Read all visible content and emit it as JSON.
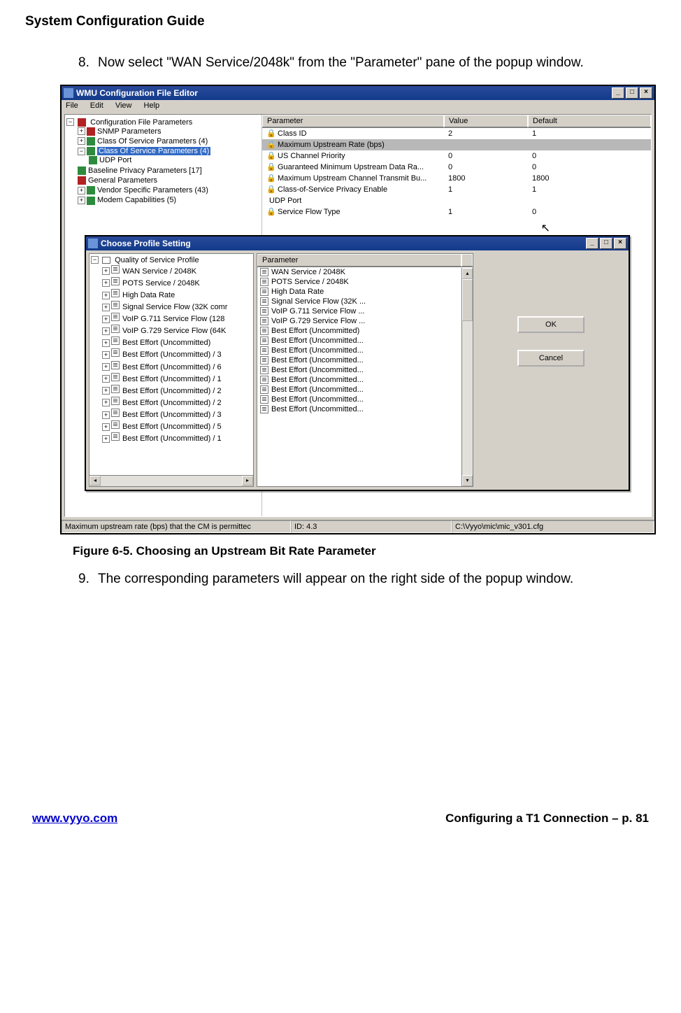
{
  "doc": {
    "guide_title": "System Configuration Guide",
    "step8_num": "8.",
    "step8": "Now select \"WAN Service/2048k\" from the \"Parameter\" pane of the popup window.",
    "figure_caption": "Figure 6-5. Choosing an Upstream Bit Rate Parameter",
    "step9_num": "9.",
    "step9": "The corresponding parameters will appear on the right side of the popup window.",
    "footer_left": "www.vyyo.com",
    "footer_right": "Configuring a T1 Connection – p. 81"
  },
  "editor": {
    "title": "WMU Configuration File Editor",
    "menu": {
      "file": "File",
      "edit": "Edit",
      "view": "View",
      "help": "Help"
    },
    "tree": {
      "root": "Configuration File Parameters",
      "items": [
        "SNMP Parameters",
        "Class Of Service Parameters (4)",
        "Class Of Service Parameters (4)",
        "UDP Port",
        "Baseline Privacy Parameters [17]",
        "General Parameters",
        "Vendor Specific Parameters (43)",
        "Modem Capabilities (5)"
      ]
    },
    "grid": {
      "headers": {
        "param": "Parameter",
        "value": "Value",
        "default": "Default"
      },
      "rows": [
        {
          "p": "Class ID",
          "v": "2",
          "d": "1"
        },
        {
          "p": "Maximum Upstream Rate (bps)",
          "v": "",
          "d": "",
          "sel": true
        },
        {
          "p": "US Channel Priority",
          "v": "0",
          "d": "0"
        },
        {
          "p": "Guaranteed Minimum Upstream Data Ra...",
          "v": "0",
          "d": "0"
        },
        {
          "p": "Maximum Upstream Channel Transmit Bu...",
          "v": "1800",
          "d": "1800"
        },
        {
          "p": "Class-of-Service Privacy Enable",
          "v": "1",
          "d": "1"
        },
        {
          "p": "UDP Port",
          "v": "",
          "d": "",
          "branch": true
        },
        {
          "p": "Service Flow Type",
          "v": "1",
          "d": "0"
        }
      ]
    },
    "status": {
      "msg": "Maximum upstream rate (bps) that the CM is permittec",
      "id": "ID: 4.3",
      "path": "C:\\Vyyo\\mic\\mic_v301.cfg"
    }
  },
  "popup": {
    "title": "Choose Profile Setting",
    "tree_root": "Quality of Service Profile",
    "tree_items": [
      "WAN Service / 2048K",
      "POTS Service / 2048K",
      "High Data Rate",
      "Signal Service Flow (32K comr",
      "VoIP G.711 Service Flow (128",
      "VoIP G.729 Service Flow (64K",
      "Best Effort (Uncommitted)",
      "Best Effort (Uncommitted) / 3",
      "Best Effort (Uncommitted) / 6",
      "Best Effort (Uncommitted) / 1",
      "Best Effort (Uncommitted) / 2",
      "Best Effort (Uncommitted) / 2",
      "Best Effort (Uncommitted) / 3",
      "Best Effort (Uncommitted) / 5",
      "Best Effort (Uncommitted) / 1"
    ],
    "list_header": "Parameter",
    "list_items": [
      "WAN Service / 2048K",
      "POTS Service / 2048K",
      "High Data Rate",
      "Signal Service Flow (32K ...",
      "VoIP G.711 Service Flow ...",
      "VoIP G.729 Service Flow ...",
      "Best Effort (Uncommitted)",
      "Best Effort (Uncommitted...",
      "Best Effort (Uncommitted...",
      "Best Effort (Uncommitted...",
      "Best Effort (Uncommitted...",
      "Best Effort (Uncommitted...",
      "Best Effort (Uncommitted...",
      "Best Effort (Uncommitted...",
      "Best Effort (Uncommitted..."
    ],
    "buttons": {
      "ok": "OK",
      "cancel": "Cancel"
    }
  }
}
